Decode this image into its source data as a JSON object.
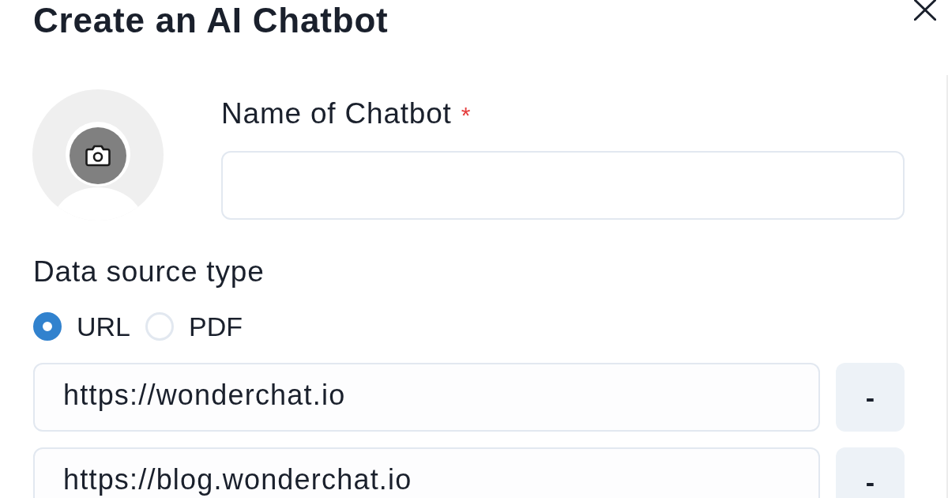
{
  "dialog": {
    "title": "Create an AI Chatbot"
  },
  "name_field": {
    "label": "Name of Chatbot",
    "required_mark": "*"
  },
  "data_source": {
    "label": "Data source type",
    "options": [
      {
        "label": "URL",
        "selected": true
      },
      {
        "label": "PDF",
        "selected": false
      }
    ]
  },
  "urls": [
    {
      "value": "https://wonderchat.io",
      "remove_label": "-"
    },
    {
      "value": "https://blog.wonderchat.io",
      "remove_label": "-"
    }
  ]
}
